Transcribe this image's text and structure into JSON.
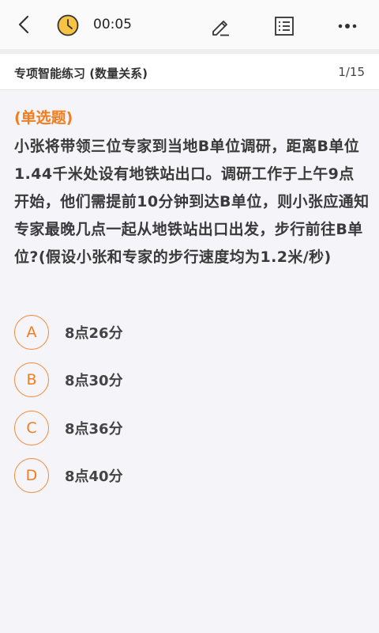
{
  "header": {
    "timer": "00:05"
  },
  "subheader": {
    "title": "专项智能练习 (数量关系)",
    "progress": "1/15"
  },
  "question": {
    "type": "(单选题)",
    "stem": "小张将带领三位专家到当地B单位调研，距离B单位1.44千米处设有地铁站出口。调研工作于上午9点开始，他们需提前10分钟到达B单位，则小张应通知专家最晚几点一起从地铁站出口出发，步行前往B单位?(假设小张和专家的步行速度均为1.2米/秒)"
  },
  "options": [
    {
      "letter": "A",
      "text": "8点26分"
    },
    {
      "letter": "B",
      "text": "8点30分"
    },
    {
      "letter": "C",
      "text": "8点36分"
    },
    {
      "letter": "D",
      "text": "8点40分"
    }
  ],
  "colors": {
    "accent": "#f07d1f",
    "clock_fill": "#f6c343"
  }
}
